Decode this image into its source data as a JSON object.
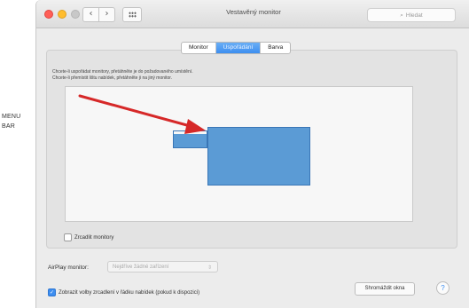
{
  "side_label": "MENU BAR",
  "window": {
    "title": "Vestavěný monitor",
    "search_placeholder": "Hledat",
    "nav": {
      "back": "‹",
      "forward": "›"
    }
  },
  "tabs": [
    {
      "label": "Monitor",
      "active": false
    },
    {
      "label": "Uspořádání",
      "active": true
    },
    {
      "label": "Barva",
      "active": false
    }
  ],
  "hint": {
    "line1": "Chcete-li uspořádat monitory, přetáhněte je do požadovaného umístění.",
    "line2": "Chcete-li přemístit lištu nabídek, přetáhněte ji na jiný monitor."
  },
  "mirror": {
    "label": "Zrcadlit monitory",
    "checked": false
  },
  "airplay": {
    "label": "AirPlay monitor:",
    "value": "Nejdříve žádné zařízení"
  },
  "show_menu": {
    "label": "Zobrazit volby zrcadlení v řádku nabídek (pokud k dispozici)",
    "checked": true
  },
  "gather_button": "Shromáždit okna",
  "help_label": "?",
  "colors": {
    "accent": "#3d8ef0",
    "monitor_fill": "#5b9bd5",
    "annotation_arrow": "#d62828"
  }
}
